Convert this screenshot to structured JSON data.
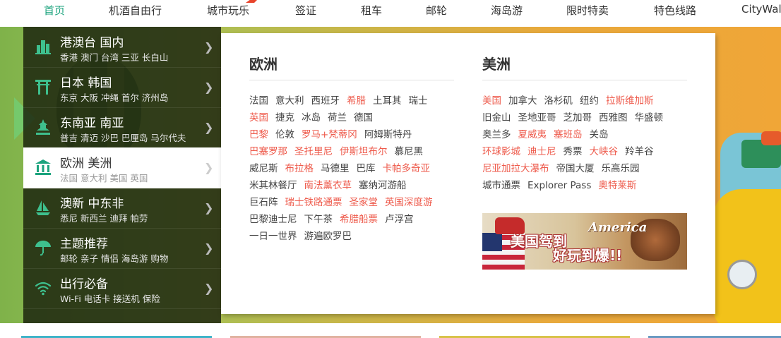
{
  "nav": {
    "items": [
      "首页",
      "机酒自由行",
      "城市玩乐",
      "签证",
      "租车",
      "邮轮",
      "海岛游",
      "限时特卖",
      "特色线路",
      "CityWal"
    ],
    "active_index": 0,
    "accent_color": "#1ba37d"
  },
  "sidebar": {
    "items": [
      {
        "title": "港澳台 国内",
        "sub": "香港 澳门 台湾 三亚 长白山",
        "icon": "city-buildings-icon"
      },
      {
        "title": "日本 韩国",
        "sub": "东京 大阪 冲绳 首尔 济州岛",
        "icon": "torii-gate-icon"
      },
      {
        "title": "东南亚 南亚",
        "sub": "普吉 清迈 沙巴 巴厘岛 马尔代夫",
        "icon": "pagoda-icon"
      },
      {
        "title": "欧洲 美洲",
        "sub": "法国 意大利 美国 英国",
        "icon": "classical-building-icon"
      },
      {
        "title": "澳新 中东非",
        "sub": "悉尼 新西兰 迪拜 帕劳",
        "icon": "sailboat-icon"
      },
      {
        "title": "主题推荐",
        "sub": "邮轮 亲子 情侣 海岛游 购物",
        "icon": "parasol-icon"
      },
      {
        "title": "出行必备",
        "sub": "Wi-Fi 电话卡 接送机 保险",
        "icon": "wifi-icon"
      }
    ],
    "active_index": 3,
    "icon_color": "#3ec08e"
  },
  "panel": {
    "europe": {
      "title": "欧洲",
      "rows": [
        [
          {
            "t": "法国"
          },
          {
            "t": "意大利"
          },
          {
            "t": "西班牙"
          },
          {
            "t": "希腊",
            "hl": true
          },
          {
            "t": "土耳其"
          },
          {
            "t": "瑞士"
          }
        ],
        [
          {
            "t": "英国",
            "hl": true
          },
          {
            "t": "捷克"
          },
          {
            "t": "冰岛"
          },
          {
            "t": "荷兰"
          },
          {
            "t": "德国"
          }
        ],
        [
          {
            "t": "巴黎",
            "hl": true
          },
          {
            "t": "伦敦"
          },
          {
            "t": "罗马+梵蒂冈",
            "hl": true
          },
          {
            "t": "阿姆斯特丹"
          }
        ],
        [
          {
            "t": "巴塞罗那",
            "hl": true
          },
          {
            "t": "圣托里尼",
            "hl": true
          },
          {
            "t": "伊斯坦布尔",
            "hl": true
          },
          {
            "t": "慕尼黑"
          }
        ],
        [
          {
            "t": "威尼斯"
          },
          {
            "t": "布拉格",
            "hl": true
          },
          {
            "t": "马德里"
          },
          {
            "t": "巴库"
          },
          {
            "t": "卡帕多奇亚",
            "hl": true
          }
        ],
        [
          {
            "t": "米其林餐厅"
          },
          {
            "t": "南法薰衣草",
            "hl": true
          },
          {
            "t": "塞纳河游船"
          }
        ],
        [
          {
            "t": "巨石阵"
          },
          {
            "t": "瑞士铁路通票",
            "hl": true
          },
          {
            "t": "圣家堂",
            "hl": true
          },
          {
            "t": "英国深度游",
            "hl": true
          }
        ],
        [
          {
            "t": "巴黎迪士尼"
          },
          {
            "t": "下午茶"
          },
          {
            "t": "希腊船票",
            "hl": true
          },
          {
            "t": "卢浮宫"
          }
        ],
        [
          {
            "t": "一日一世界"
          },
          {
            "t": "游遍欧罗巴"
          }
        ]
      ]
    },
    "america": {
      "title": "美洲",
      "rows": [
        [
          {
            "t": "美国",
            "hl": true
          },
          {
            "t": "加拿大"
          },
          {
            "t": "洛杉矶"
          },
          {
            "t": "纽约"
          },
          {
            "t": "拉斯维加斯",
            "hl": true
          }
        ],
        [
          {
            "t": "旧金山"
          },
          {
            "t": "圣地亚哥"
          },
          {
            "t": "芝加哥"
          },
          {
            "t": "西雅图"
          },
          {
            "t": "华盛顿"
          }
        ],
        [
          {
            "t": "奥兰多"
          },
          {
            "t": "夏威夷",
            "hl": true
          },
          {
            "t": "塞班岛",
            "hl": true
          },
          {
            "t": "关岛"
          }
        ],
        [
          {
            "t": "环球影城",
            "hl": true
          },
          {
            "t": "迪士尼",
            "hl": true
          },
          {
            "t": "秀票"
          },
          {
            "t": "大峡谷",
            "hl": true
          },
          {
            "t": "羚羊谷"
          }
        ],
        [
          {
            "t": "尼亚加拉大瀑布",
            "hl": true
          },
          {
            "t": "帝国大厦"
          },
          {
            "t": "乐高乐园"
          }
        ],
        [
          {
            "t": "城市通票"
          },
          {
            "t": "Explorer Pass"
          },
          {
            "t": "奥特莱斯",
            "hl": true
          }
        ]
      ],
      "promo": {
        "line1": "美国",
        "line1b": "驾到",
        "line2": "好玩到爆!!",
        "logo": "America"
      }
    },
    "highlight_color": "#ee5a4b"
  }
}
